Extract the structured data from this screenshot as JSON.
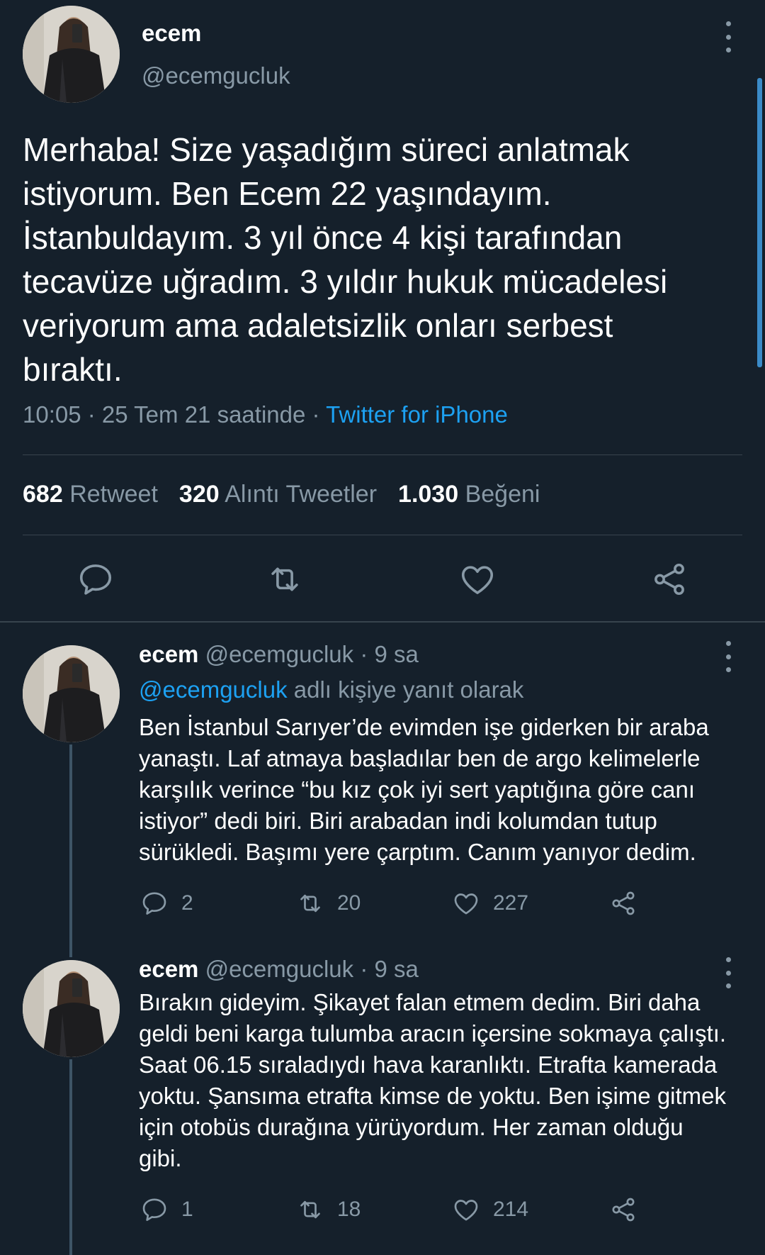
{
  "main_tweet": {
    "author_name": "ecem",
    "author_handle": "@ecemgucluk",
    "text": "Merhaba! Size yaşadığım süreci anlatmak\nistiyorum. Ben Ecem 22 yaşındayım.\nİstanbuldayım. 3 yıl önce 4 kişi tarafından\ntecavüze uğradım. 3 yıldır hukuk mücadelesi\nveriyorum ama adaletsizlik onları serbest\nbıraktı.",
    "timestamp": "10:05 · 25 Tem 21 saatinde · ",
    "source": "Twitter for iPhone",
    "stats": {
      "retweets_count": "682",
      "retweets_label": "Retweet",
      "quotes_count": "320",
      "quotes_label": "Alıntı Tweetler",
      "likes_count": "1.030",
      "likes_label": "Beğeni"
    },
    "icons": [
      "reply-icon",
      "retweet-icon",
      "like-icon",
      "share-icon",
      "more-icon"
    ]
  },
  "replies": [
    {
      "author_name": "ecem",
      "meta": "@ecemgucluk · 9 sa",
      "reply_to_mention": "@ecemgucluk",
      "reply_to_suffix": " adlı kişiye yanıt olarak",
      "text": "Ben İstanbul Sarıyer’de evimden işe giderken bir araba\nyanaştı. Laf atmaya başladılar ben de argo kelimelerle\nkarşılık verince “bu kız çok iyi sert yaptığına göre canı\nistiyor” dedi biri. Biri arabadan indi kolumdan tutup\nsürükledi. Başımı yere çarptım. Canım yanıyor dedim.",
      "replies_count": "2",
      "retweets_count": "20",
      "likes_count": "227"
    },
    {
      "author_name": "ecem",
      "meta": "@ecemgucluk · 9 sa",
      "text": "Bırakın gideyim. Şikayet falan etmem dedim. Biri daha\ngeldi beni karga tulumba aracın içersine sokmaya çalıştı.\nSaat 06.15 sıraladıydı hava karanlıktı. Etrafta kamerada\nyoktu. Şansıma etrafta kimse de yoktu. Ben işime gitmek\niçin otobüs durağına yürüyordum. Her zaman olduğu\ngibi.",
      "replies_count": "1",
      "retweets_count": "18",
      "likes_count": "214"
    }
  ],
  "colors": {
    "background": "#15202b",
    "text_primary": "#ffffff",
    "text_secondary": "#8899a6",
    "accent": "#1da1f2",
    "divider": "#38444d"
  }
}
